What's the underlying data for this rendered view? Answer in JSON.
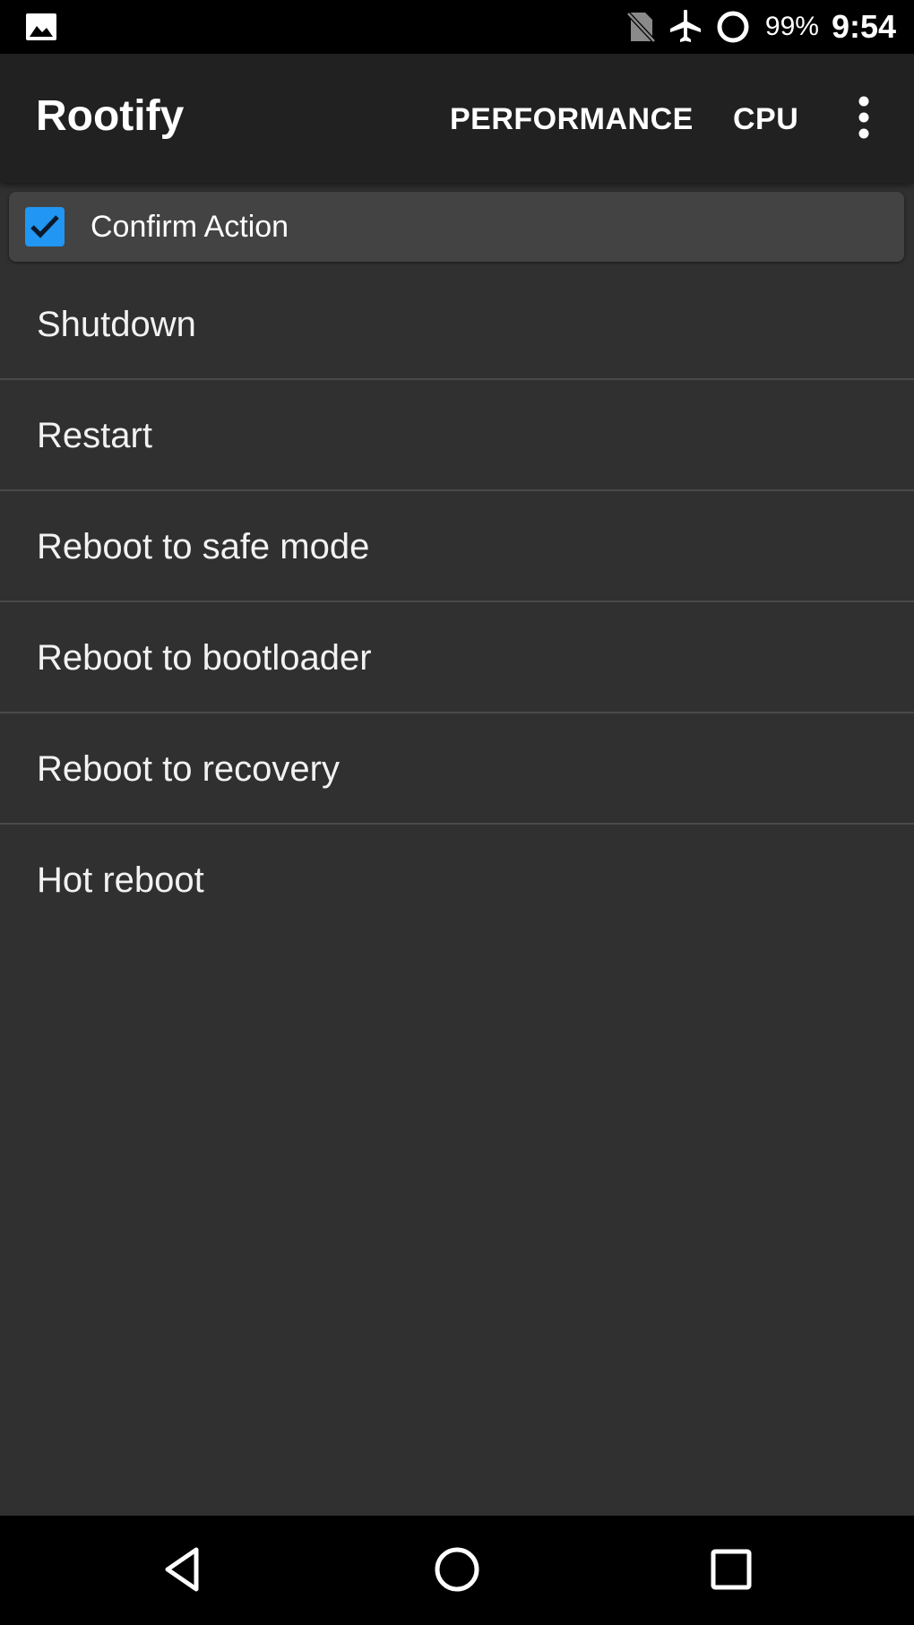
{
  "status_bar": {
    "left_icon": "image-icon",
    "icons": [
      "no-sim-icon",
      "airplane-mode-icon",
      "battery-ring-icon"
    ],
    "battery": "99%",
    "time": "9:54"
  },
  "app_bar": {
    "title": "Rootify",
    "actions": [
      "PERFORMANCE",
      "CPU"
    ],
    "overflow_icon": "more-vert-icon"
  },
  "confirm": {
    "label": "Confirm Action",
    "checked": true,
    "accent": "#2196f3"
  },
  "items": [
    {
      "label": "Shutdown"
    },
    {
      "label": "Restart"
    },
    {
      "label": "Reboot to safe mode"
    },
    {
      "label": "Reboot to bootloader"
    },
    {
      "label": "Reboot to recovery"
    },
    {
      "label": "Hot reboot"
    }
  ],
  "nav": {
    "icons": [
      "back-icon",
      "home-icon",
      "recents-icon"
    ]
  }
}
